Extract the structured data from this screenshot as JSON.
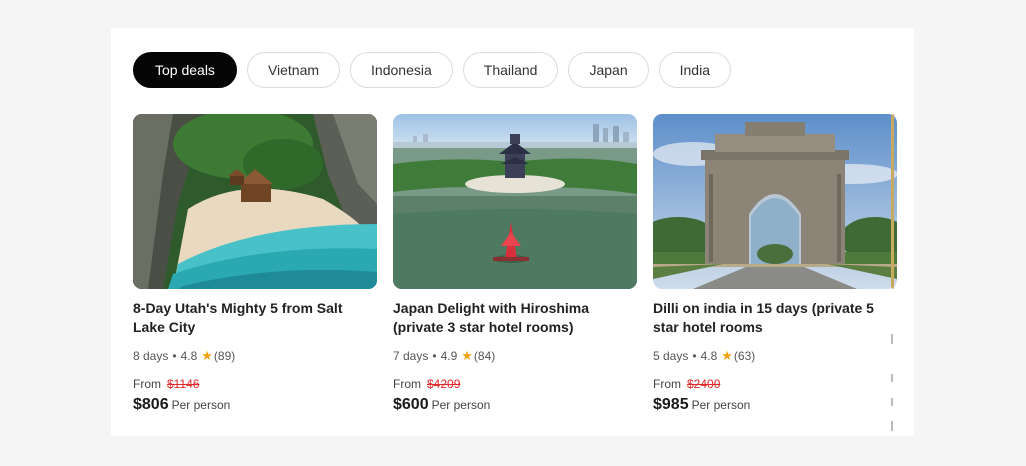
{
  "tabs": [
    {
      "label": "Top deals",
      "active": true
    },
    {
      "label": "Vietnam",
      "active": false
    },
    {
      "label": "Indonesia",
      "active": false
    },
    {
      "label": "Thailand",
      "active": false
    },
    {
      "label": "Japan",
      "active": false
    },
    {
      "label": "India",
      "active": false
    }
  ],
  "cards": [
    {
      "image": "tropical-beach-huts-photo",
      "title": "8-Day Utah's Mighty 5 from Salt Lake City",
      "days": "8 days",
      "rating": "4.8",
      "reviews": "(89)",
      "from_label": "From",
      "old_price": "$1146",
      "price": "$806",
      "price_unit": "Per person"
    },
    {
      "image": "japan-lake-pagoda-photo",
      "title": "Japan Delight with Hiroshima (private 3 star hotel rooms)",
      "days": "7 days",
      "rating": "4.9",
      "reviews": "(84)",
      "from_label": "From",
      "old_price": "$4209",
      "price": "$600",
      "price_unit": "Per person"
    },
    {
      "image": "india-gate-photo",
      "title": "Dilli on india in 15 days (private 5 star hotel rooms",
      "days": "5 days",
      "rating": "4.8",
      "reviews": "(63)",
      "from_label": "From",
      "old_price": "$2400",
      "price": "$985",
      "price_unit": "Per person"
    }
  ],
  "meta_separator": "•",
  "star_icon": "★",
  "colors": {
    "active_tab_bg": "#050505",
    "star": "#f2a20c",
    "old_price": "#e02828"
  }
}
